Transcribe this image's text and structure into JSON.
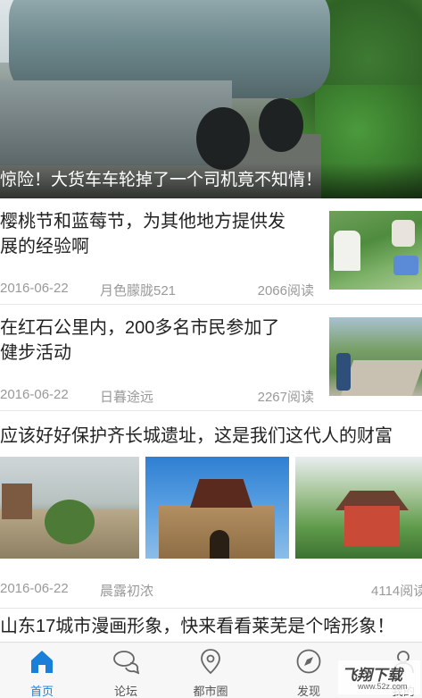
{
  "hero": {
    "caption": "惊险！大货车车轮掉了一个司机竟不知情！"
  },
  "news": [
    {
      "title_line1": "樱桃节和蓝莓节，为其他地方提供发",
      "title_line2": "展的经验啊",
      "date": "2016-06-22",
      "author": "月色朦胧521",
      "reads": "2066阅读"
    },
    {
      "title_line1": "在红石公里内，200多名市民参加了",
      "title_line2": "健步活动",
      "date": "2016-06-22",
      "author": "日暮途远",
      "reads": "2267阅读"
    },
    {
      "title_line1": "应该好好保护齐长城遗址，这是我们这代人的财富",
      "date": "2016-06-22",
      "author": "晨露初浓",
      "reads": "4114阅读"
    },
    {
      "title_line1": "山东17城市漫画形象，快来看看莱芜是个啥形象！"
    }
  ],
  "tabs": [
    {
      "label": "首页",
      "icon": "home-icon",
      "active": true
    },
    {
      "label": "论坛",
      "icon": "chat-bubbles-icon"
    },
    {
      "label": "都市圈",
      "icon": "location-pin-icon"
    },
    {
      "label": "发现",
      "icon": "compass-icon"
    },
    {
      "label": "我的",
      "icon": "user-icon"
    }
  ],
  "watermark": {
    "brand": "飞翔下载",
    "url": "www.52z.com"
  },
  "colors": {
    "accent": "#1a7fd9",
    "meta_text": "#999999"
  }
}
